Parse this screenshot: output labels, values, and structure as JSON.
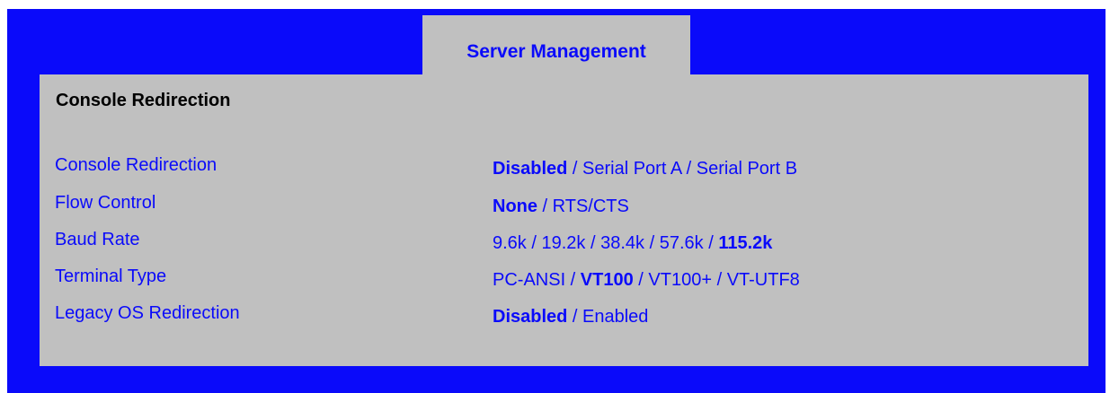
{
  "header": {
    "tab_label": "Server Management"
  },
  "section": {
    "title": "Console Redirection"
  },
  "settings": [
    {
      "label": "Console Redirection",
      "options": [
        "Disabled",
        "Serial Port A",
        "Serial Port B"
      ],
      "selected": 0
    },
    {
      "label": "Flow Control",
      "options": [
        "None",
        "RTS/CTS"
      ],
      "selected": 0
    },
    {
      "label": "Baud Rate",
      "options": [
        "9.6k",
        "19.2k",
        "38.4k",
        "57.6k",
        "115.2k"
      ],
      "selected": 4
    },
    {
      "label": "Terminal Type",
      "options": [
        "PC-ANSI",
        "VT100",
        "VT100+",
        "VT-UTF8"
      ],
      "selected": 1
    },
    {
      "label": "Legacy OS Redirection",
      "options": [
        "Disabled",
        "Enabled"
      ],
      "selected": 0
    }
  ],
  "colors": {
    "frame": "#0a0afa",
    "panel": "#c0c0c0",
    "text": "#0a0afa"
  },
  "separator": " / "
}
